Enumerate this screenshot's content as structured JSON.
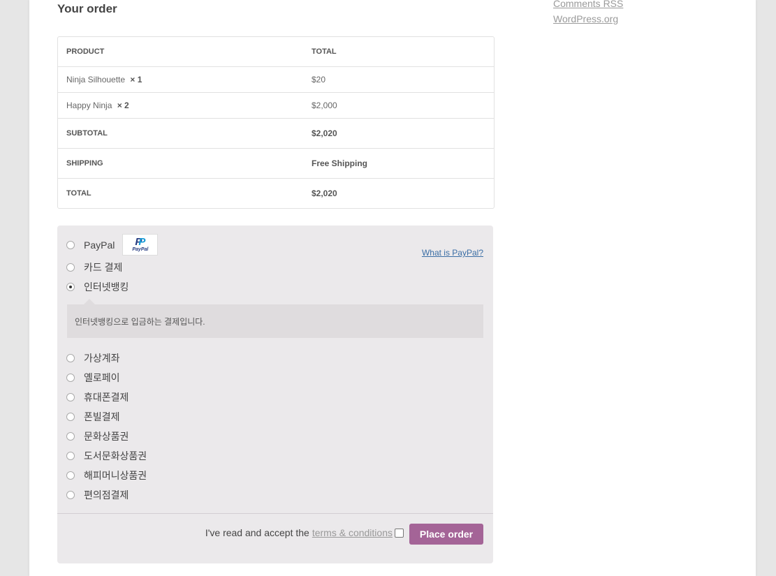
{
  "sidebar": {
    "links": [
      "Comments RSS",
      "WordPress.org"
    ]
  },
  "order": {
    "heading": "Your order",
    "columns": {
      "product": "PRODUCT",
      "total": "TOTAL"
    },
    "items": [
      {
        "name": "Ninja Silhouette",
        "qty": "× 1",
        "total": "$20"
      },
      {
        "name": "Happy Ninja",
        "qty": "× 2",
        "total": "$2,000"
      }
    ],
    "subtotal": {
      "label": "SUBTOTAL",
      "value": "$2,020"
    },
    "shipping": {
      "label": "SHIPPING",
      "value": "Free Shipping"
    },
    "total": {
      "label": "TOTAL",
      "value": "$2,020"
    }
  },
  "payment": {
    "paypal": {
      "label": "PayPal",
      "logo_word": "PayPal",
      "what_link": "What is PayPal?"
    },
    "methods": [
      "카드 결제",
      "인터넷뱅킹",
      "가상계좌",
      "옐로페이",
      "휴대폰결제",
      "폰빌결제",
      "문화상품권",
      "도서문화상품권",
      "해피머니상품권",
      "편의점결제"
    ],
    "selected": "인터넷뱅킹",
    "selected_description": "인터넷뱅킹으로 입금하는 결제입니다.",
    "terms_prefix": "I've read and accept the",
    "terms_link": "terms & conditions",
    "place_order": "Place order",
    "accent_color": "#a46497"
  }
}
